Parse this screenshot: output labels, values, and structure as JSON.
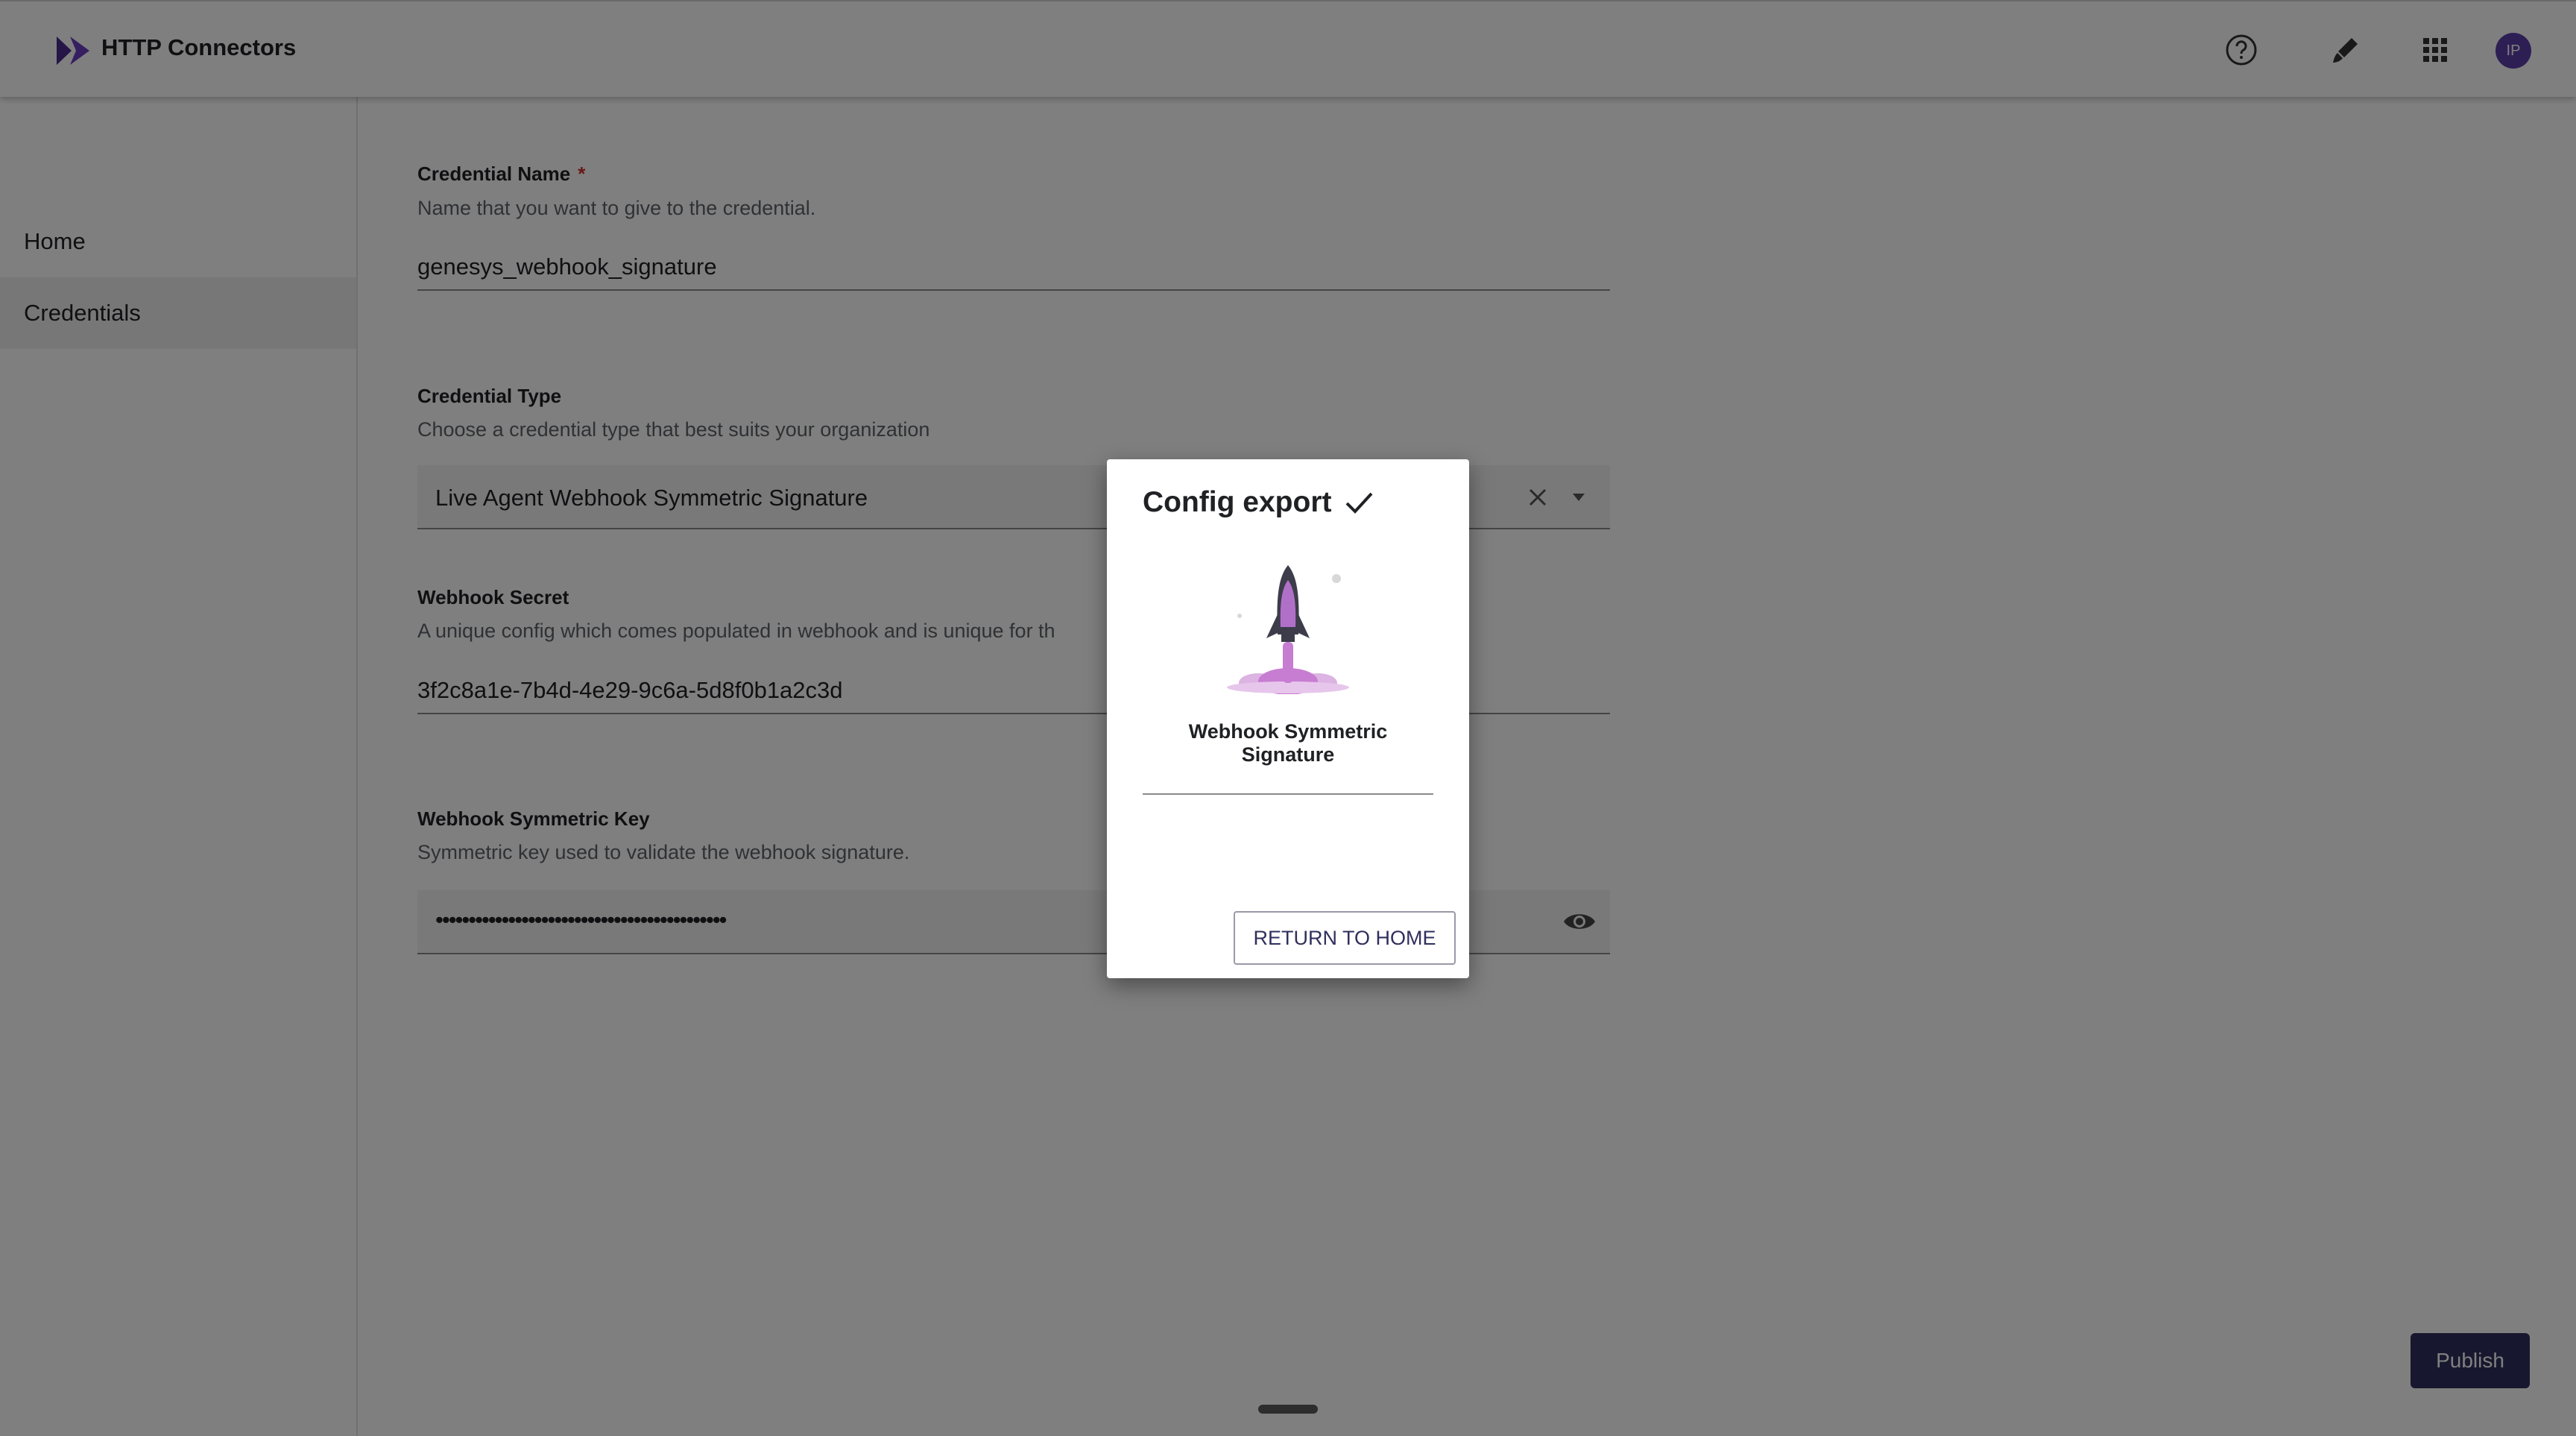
{
  "header": {
    "app_title": "HTTP Connectors",
    "icons": [
      "help-icon",
      "brush-icon",
      "apps-grid-icon"
    ],
    "avatar_initials": "IP"
  },
  "sidebar": {
    "items": [
      {
        "label": "Home",
        "active": false
      },
      {
        "label": "Credentials",
        "active": true
      }
    ]
  },
  "form": {
    "credential_name": {
      "label": "Credential Name",
      "required_mark": "*",
      "description": "Name that you want to give to the credential.",
      "value": "genesys_webhook_signature"
    },
    "credential_type": {
      "label": "Credential Type",
      "description": "Choose a credential type that best suits your organization",
      "value": "Live Agent Webhook Symmetric Signature"
    },
    "webhook_secret": {
      "label": "Webhook Secret",
      "description": "A unique config which comes populated in webhook and is unique for th",
      "value": "3f2c8a1e-7b4d-4e29-9c6a-5d8f0b1a2c3d"
    },
    "webhook_symmetric_key": {
      "label": "Webhook Symmetric Key",
      "description": "Symmetric key used to validate the webhook signature.",
      "value": "••••••••••••••••••••••••••••••••••••••••••••"
    }
  },
  "publish_label": "Publish",
  "dialog": {
    "title": "Config export",
    "subtitle": "Webhook Symmetric Signature",
    "return_label": "RETURN TO HOME"
  },
  "colors": {
    "primary": "#2f2f5e",
    "accent_purple": "#5b3fa8",
    "required": "#d32f2f",
    "rocket_flame": "#c77dd1"
  }
}
